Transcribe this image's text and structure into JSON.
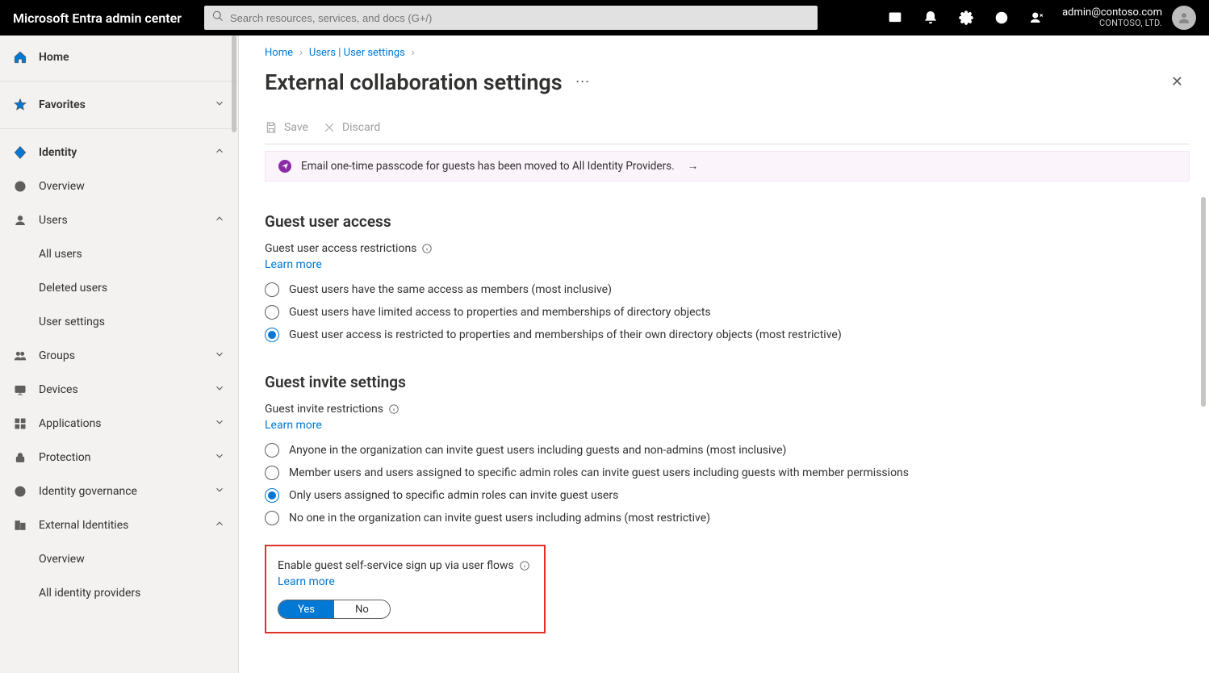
{
  "header": {
    "brand": "Microsoft Entra admin center",
    "search_placeholder": "Search resources, services, and docs (G+/)",
    "account_email": "admin@contoso.com",
    "account_org": "CONTOSO, LTD."
  },
  "sidebar": {
    "home": "Home",
    "favorites": "Favorites",
    "identity": "Identity",
    "overview": "Overview",
    "users": "Users",
    "users_children": {
      "all": "All users",
      "deleted": "Deleted users",
      "settings": "User settings"
    },
    "groups": "Groups",
    "devices": "Devices",
    "applications": "Applications",
    "protection": "Protection",
    "id_gov": "Identity governance",
    "ext_ids": "External Identities",
    "ext_children": {
      "overview": "Overview",
      "providers": "All identity providers"
    }
  },
  "breadcrumbs": {
    "home": "Home",
    "users": "Users | User settings"
  },
  "page": {
    "title": "External collaboration settings"
  },
  "toolbar": {
    "save": "Save",
    "discard": "Discard"
  },
  "infobar": {
    "text": "Email one-time passcode for guests has been moved to All Identity Providers."
  },
  "guest_access": {
    "heading": "Guest user access",
    "sublabel": "Guest user access restrictions",
    "learn": "Learn more",
    "options": [
      "Guest users have the same access as members (most inclusive)",
      "Guest users have limited access to properties and memberships of directory objects",
      "Guest user access is restricted to properties and memberships of their own directory objects (most restrictive)"
    ],
    "selected_index": 2
  },
  "guest_invite": {
    "heading": "Guest invite settings",
    "sublabel": "Guest invite restrictions",
    "learn": "Learn more",
    "options": [
      "Anyone in the organization can invite guest users including guests and non-admins (most inclusive)",
      "Member users and users assigned to specific admin roles can invite guest users including guests with member permissions",
      "Only users assigned to specific admin roles can invite guest users",
      "No one in the organization can invite guest users including admins (most restrictive)"
    ],
    "selected_index": 2
  },
  "self_service": {
    "label": "Enable guest self-service sign up via user flows",
    "learn": "Learn more",
    "yes": "Yes",
    "no": "No",
    "value": "Yes"
  }
}
